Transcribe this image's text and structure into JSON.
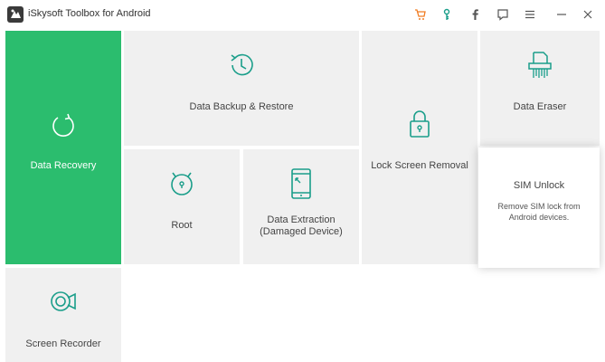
{
  "window": {
    "title": "iSkysoft Toolbox for Android",
    "controls": [
      "cart-icon",
      "key-icon",
      "facebook-icon",
      "feedback-icon",
      "menu-icon",
      "minimize-icon",
      "close-icon"
    ]
  },
  "colors": {
    "accent": "#2bbd6e",
    "icon_teal": "#1a9e8a",
    "cart_orange": "#f07c22",
    "tile_bg": "#f0f0f0"
  },
  "tiles": {
    "data_recovery": {
      "label": "Data Recovery",
      "icon": "refresh-icon"
    },
    "data_backup": {
      "label": "Data Backup & Restore",
      "icon": "clock-backup-icon"
    },
    "lock_screen": {
      "label": "Lock Screen Removal",
      "icon": "padlock-icon"
    },
    "data_eraser": {
      "label": "Data Eraser",
      "icon": "shredder-icon"
    },
    "root": {
      "label": "Root",
      "icon": "android-root-icon"
    },
    "data_extraction": {
      "label": "Data Extraction (Damaged Device)",
      "icon": "broken-phone-icon"
    },
    "screen_recorder": {
      "label": "Screen Recorder",
      "icon": "video-camera-icon"
    }
  },
  "sim_unlock": {
    "title": "SIM Unlock",
    "description": "Remove SIM lock from Android devices."
  }
}
